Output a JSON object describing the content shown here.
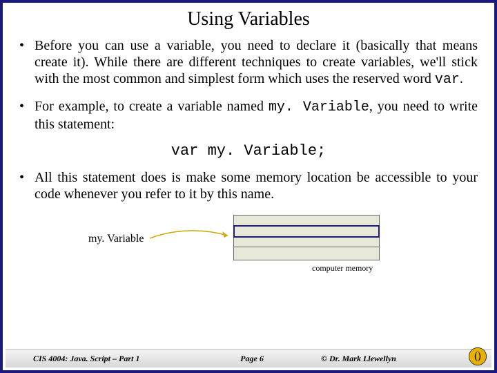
{
  "slide": {
    "title": "Using Variables",
    "bullets": [
      {
        "pre": "Before you can use a variable, you need to declare it (basically that means create it).  While there are different techniques to create variables, we'll stick with the most common and simplest form which uses the reserved word ",
        "code": "var",
        "post": "."
      },
      {
        "pre": "For example, to create a variable named ",
        "code": "my. Variable",
        "post": ", you need to write this statement:"
      },
      {
        "pre": "All this statement does is make some memory location be accessible to your code whenever you refer to it by this name.",
        "code": "",
        "post": ""
      }
    ],
    "code_line": "var my. Variable;",
    "diagram": {
      "pointer_label": "my. Variable",
      "caption": "computer memory"
    },
    "footer": {
      "left": "CIS 4004: Java. Script – Part 1",
      "center": "Page 6",
      "right": "© Dr. Mark Llewellyn"
    }
  }
}
